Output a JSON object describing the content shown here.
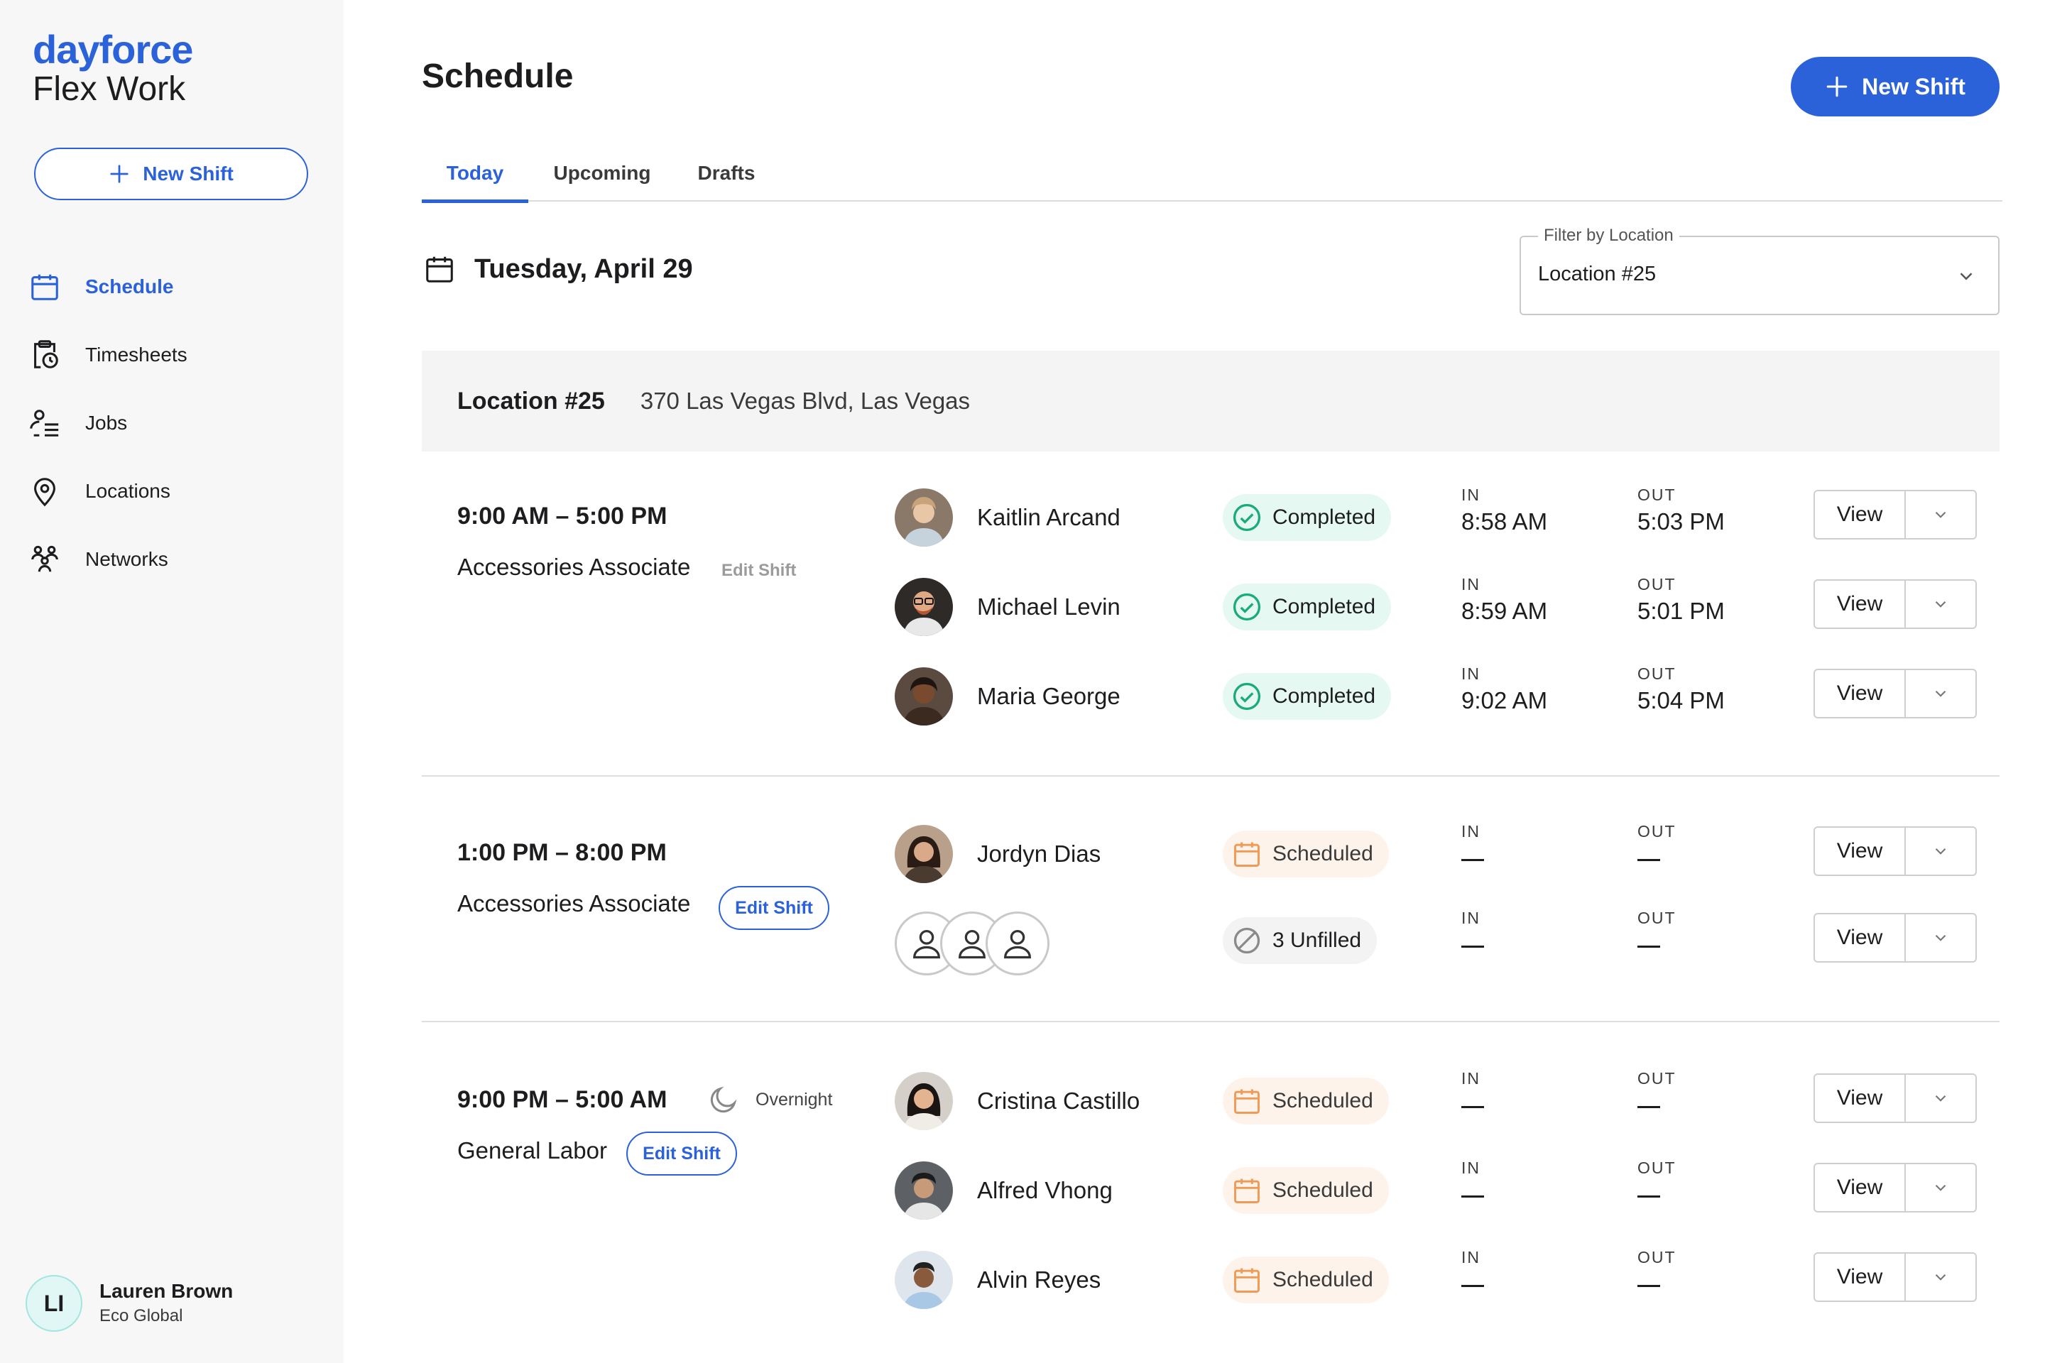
{
  "brand": {
    "logo_top": "dayforce",
    "logo_bottom": "Flex Work",
    "accent": "#2b62d9"
  },
  "sidebar": {
    "new_shift_label": "New Shift",
    "items": [
      {
        "label": "Schedule",
        "icon": "calendar-icon",
        "active": true
      },
      {
        "label": "Timesheets",
        "icon": "timesheet-icon",
        "active": false
      },
      {
        "label": "Jobs",
        "icon": "jobs-icon",
        "active": false
      },
      {
        "label": "Locations",
        "icon": "location-pin-icon",
        "active": false
      },
      {
        "label": "Networks",
        "icon": "network-icon",
        "active": false
      }
    ],
    "user": {
      "initials": "LI",
      "name": "Lauren Brown",
      "org": "Eco Global"
    }
  },
  "header": {
    "title": "Schedule",
    "new_shift_label": "New Shift"
  },
  "tabs": [
    {
      "label": "Today",
      "active": true
    },
    {
      "label": "Upcoming",
      "active": false
    },
    {
      "label": "Drafts",
      "active": false
    }
  ],
  "date": "Tuesday, April 29",
  "filter": {
    "label": "Filter by Location",
    "value": "Location #25"
  },
  "location": {
    "name": "Location #25",
    "address": "370 Las Vegas Blvd, Las Vegas"
  },
  "labels": {
    "in": "IN",
    "out": "OUT",
    "view": "View",
    "edit_shift": "Edit Shift",
    "overnight": "Overnight"
  },
  "shifts": [
    {
      "time": "9:00 AM – 5:00 PM",
      "role": "Accessories Associate",
      "edit": "Edit Shift",
      "workers": [
        {
          "name": "Kaitlin Arcand",
          "status": "Completed",
          "in": "8:58 AM",
          "out": "5:03 PM"
        },
        {
          "name": "Michael Levin",
          "status": "Completed",
          "in": "8:59 AM",
          "out": "5:01 PM"
        },
        {
          "name": "Maria George",
          "status": "Completed",
          "in": "9:02 AM",
          "out": "5:04 PM"
        }
      ]
    },
    {
      "time": "1:00 PM – 8:00 PM",
      "role": "Accessories Associate",
      "edit": "Edit Shift",
      "workers": [
        {
          "name": "Jordyn Dias",
          "status": "Scheduled",
          "in": "—",
          "out": "—"
        }
      ],
      "unfilled": {
        "status": "3 Unfilled"
      }
    },
    {
      "time": "9:00 PM – 5:00 AM",
      "overnight": "Overnight",
      "role": "General Labor",
      "edit": "Edit Shift",
      "workers": [
        {
          "name": "Cristina Castillo",
          "status": "Scheduled",
          "in": "—",
          "out": "—"
        },
        {
          "name": "Alfred Vhong",
          "status": "Scheduled",
          "in": "—",
          "out": "—"
        },
        {
          "name": "Alvin Reyes",
          "status": "Scheduled",
          "in": "—",
          "out": "—"
        }
      ]
    }
  ]
}
